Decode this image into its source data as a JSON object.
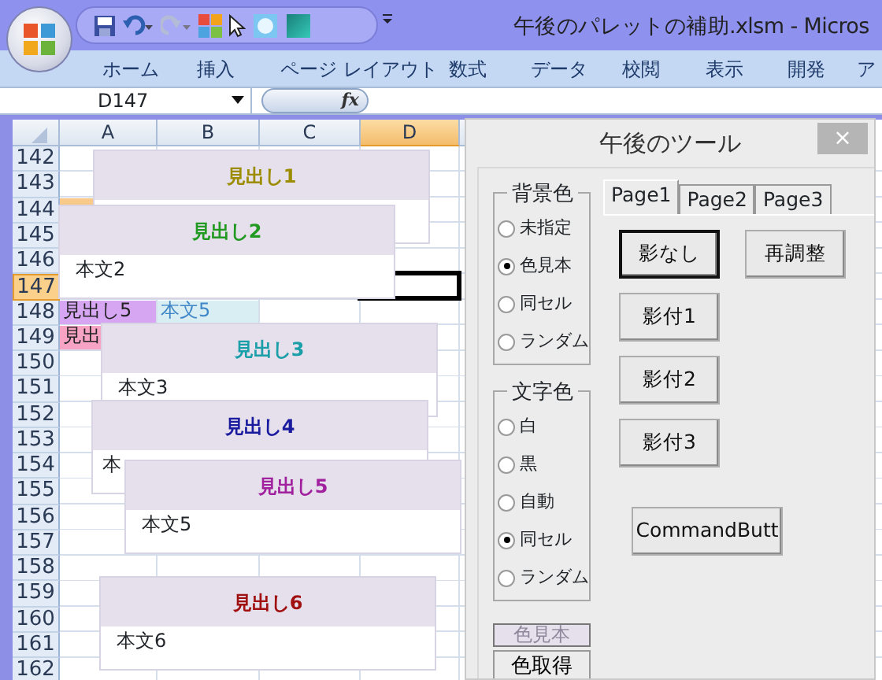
{
  "window": {
    "title": "午後のパレットの補助.xlsm - Micros"
  },
  "ribbon_tabs": [
    {
      "label": "ホーム"
    },
    {
      "label": "挿入"
    },
    {
      "label": "ページ レイアウト"
    },
    {
      "label": "数式"
    },
    {
      "label": "データ"
    },
    {
      "label": "校閲"
    },
    {
      "label": "表示"
    },
    {
      "label": "開発"
    },
    {
      "label": "ア"
    }
  ],
  "formula_bar": {
    "name_box": "D147",
    "function_label": "fx"
  },
  "sheet": {
    "columns": [
      {
        "label": "A",
        "selected": false
      },
      {
        "label": "B",
        "selected": false
      },
      {
        "label": "C",
        "selected": false
      },
      {
        "label": "D",
        "selected": true
      }
    ],
    "rows": [
      {
        "header": "142",
        "selected": false
      },
      {
        "header": "143",
        "selected": false
      },
      {
        "header": "144",
        "selected": false,
        "cells": [
          {
            "color": "#f9c98a"
          }
        ]
      },
      {
        "header": "145",
        "selected": false
      },
      {
        "header": "146",
        "selected": false
      },
      {
        "header": "147",
        "selected": true
      },
      {
        "header": "148",
        "selected": false,
        "cells": [
          {
            "text": "見出し5",
            "color": "#d6a6f3"
          },
          {
            "text": "本文5",
            "color": "#d8eef2"
          }
        ]
      },
      {
        "header": "149",
        "selected": false,
        "cells": [
          {
            "text": "見出",
            "color": "#f7a3c4"
          }
        ]
      },
      {
        "header": "150",
        "selected": false
      },
      {
        "header": "151",
        "selected": false
      },
      {
        "header": "152",
        "selected": false
      },
      {
        "header": "153",
        "selected": false
      },
      {
        "header": "154",
        "selected": false
      },
      {
        "header": "155",
        "selected": false
      },
      {
        "header": "156",
        "selected": false
      },
      {
        "header": "157",
        "selected": false
      },
      {
        "header": "158",
        "selected": false
      },
      {
        "header": "159",
        "selected": false
      },
      {
        "header": "160",
        "selected": false
      },
      {
        "header": "161",
        "selected": false
      },
      {
        "header": "162",
        "selected": false
      }
    ]
  },
  "shapes": [
    {
      "heading": "見出し1",
      "color": "#9c8c00"
    },
    {
      "heading": "見出し2",
      "body": "本文2",
      "color": "#229a22"
    },
    {
      "heading": "見出し3",
      "body": "本文3",
      "color": "#1a9ea8"
    },
    {
      "heading": "見出し4",
      "body": "本",
      "color": "#1a1a9e"
    },
    {
      "heading": "見出し5",
      "body": "本文5",
      "color": "#a0209e"
    },
    {
      "heading": "見出し6",
      "body": "本文6",
      "color": "#a01010"
    }
  ],
  "dialog": {
    "title": "午後のツール",
    "close": "×",
    "groups": [
      {
        "title": "背景色",
        "options": [
          {
            "label": "未指定",
            "selected": false
          },
          {
            "label": "色見本",
            "selected": true
          },
          {
            "label": "同セル",
            "selected": false
          },
          {
            "label": "ランダム",
            "selected": false
          }
        ]
      },
      {
        "title": "文字色",
        "options": [
          {
            "label": "白",
            "selected": false
          },
          {
            "label": "黒",
            "selected": false
          },
          {
            "label": "自動",
            "selected": false
          },
          {
            "label": "同セル",
            "selected": true
          },
          {
            "label": "ランダム",
            "selected": false
          }
        ]
      }
    ],
    "swatch_label": "色見本",
    "pick_button": "色取得",
    "tabs": [
      {
        "label": "Page1",
        "selected": true
      },
      {
        "label": "Page2",
        "selected": false
      },
      {
        "label": "Page3",
        "selected": false
      }
    ],
    "buttons": [
      {
        "label": "影なし",
        "default": true
      },
      {
        "label": "再調整",
        "default": false
      },
      {
        "label": "影付1",
        "default": false
      },
      {
        "label": "影付2",
        "default": false
      },
      {
        "label": "影付3",
        "default": false
      },
      {
        "label": "CommandButt",
        "default": false
      }
    ]
  }
}
